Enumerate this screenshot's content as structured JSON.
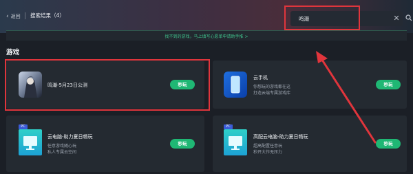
{
  "header": {
    "back_label": "返回",
    "page_title": "搜索结果（4）",
    "search_value": "鸣潮"
  },
  "notice": {
    "text": "找不到的游戏，马上填写心愿单申请助手推 >"
  },
  "section": {
    "title": "游戏"
  },
  "cards": [
    {
      "title": "鸣潮-5月23日公测",
      "desc": [],
      "button": "秒玩",
      "pc": ""
    },
    {
      "title": "云手机",
      "desc": [
        "你想玩的游戏都在这",
        "打造云端专属游戏库"
      ],
      "button": "秒玩",
      "pc": ""
    },
    {
      "title": "云电脑-助力夏日畅玩",
      "desc": [
        "任意游戏随心玩",
        "私人专属云空间"
      ],
      "button": "秒玩",
      "pc": "PC"
    },
    {
      "title": "高配云电脑-助力夏日畅玩",
      "desc": [
        "超高配置任意玩",
        "秒开大作无压力"
      ],
      "button": "秒玩",
      "pc": "PC"
    }
  ],
  "colors": {
    "accent": "#1fb774",
    "annotation_red": "#e0353c",
    "background": "#1b1f26",
    "card": "#242a31"
  }
}
